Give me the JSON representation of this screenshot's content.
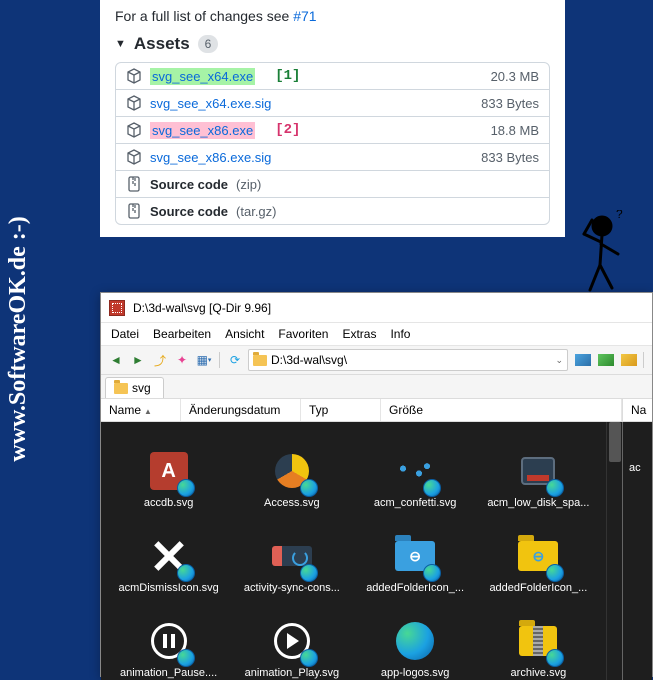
{
  "watermark": "www.SoftwareOK.de :-)",
  "github": {
    "note_prefix": "For a full list of changes see ",
    "note_link": "#71",
    "assets_label": "Assets",
    "assets_count": "6",
    "rows": [
      {
        "name": "svg_see_x64.exe",
        "size": "20.3 MB",
        "type": "cube",
        "hl": "green",
        "anno": "[1]"
      },
      {
        "name": "svg_see_x64.exe.sig",
        "size": "833 Bytes",
        "type": "cube"
      },
      {
        "name": "svg_see_x86.exe",
        "size": "18.8 MB",
        "type": "cube",
        "hl": "pink",
        "anno": "[2]"
      },
      {
        "name": "svg_see_x86.exe.sig",
        "size": "833 Bytes",
        "type": "cube"
      },
      {
        "name": "Source code",
        "suffix": "(zip)",
        "type": "zip",
        "bold": true
      },
      {
        "name": "Source code",
        "suffix": "(tar.gz)",
        "type": "zip",
        "bold": true
      }
    ]
  },
  "fm": {
    "title": "D:\\3d-wal\\svg  [Q-Dir 9.96]",
    "menu": [
      "Datei",
      "Bearbeiten",
      "Ansicht",
      "Favoriten",
      "Extras",
      "Info"
    ],
    "path": "D:\\3d-wal\\svg\\",
    "tab_label": "svg",
    "columns": {
      "c1": "Name",
      "c2": "Änderungsdatum",
      "c3": "Typ",
      "c4": "Größe"
    },
    "right_col": "Na",
    "files": [
      {
        "label": "accdb.svg",
        "shape": "access",
        "badge": true
      },
      {
        "label": "Access.svg",
        "shape": "access2",
        "badge": true
      },
      {
        "label": "acm_confetti.svg",
        "shape": "confetti",
        "badge": true
      },
      {
        "label": "acm_low_disk_spa...",
        "shape": "disk",
        "badge": true
      },
      {
        "label": "acmDismissIcon.svg",
        "shape": "x",
        "badge": true
      },
      {
        "label": "activity-sync-cons...",
        "shape": "sync",
        "badge": true
      },
      {
        "label": "addedFolderIcon_...",
        "shape": "folder-link",
        "badge": true
      },
      {
        "label": "addedFolderIcon_...",
        "shape": "folder-link-y",
        "badge": true
      },
      {
        "label": "animation_Pause....",
        "shape": "pause",
        "badge": true
      },
      {
        "label": "animation_Play.svg",
        "shape": "play",
        "badge": true
      },
      {
        "label": "app-logos.svg",
        "shape": "edge",
        "badge": false
      },
      {
        "label": "archive.svg",
        "shape": "archive",
        "badge": true
      }
    ],
    "right_item": "ac"
  }
}
